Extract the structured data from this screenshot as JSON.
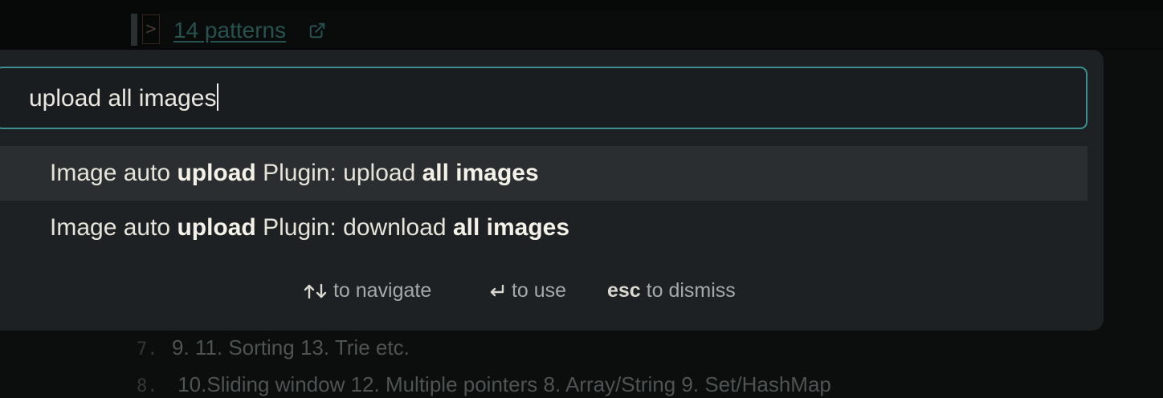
{
  "editor": {
    "link_text": "14 patterns",
    "caret_marker": ">",
    "lines": [
      {
        "number": "7.",
        "text": "9.  11. Sorting  13. Trie etc."
      },
      {
        "number": "8.",
        "text": " 10.Sliding window 12. Multiple pointers 8. Array/String 9. Set/HashMap"
      }
    ]
  },
  "palette": {
    "query": "upload all images",
    "suggestions": [
      {
        "parts": [
          "Image auto ",
          "upload",
          " Plugin: upload ",
          "all images"
        ],
        "selected": true
      },
      {
        "parts": [
          "Image auto ",
          "upload",
          " Plugin: download ",
          "all images"
        ],
        "selected": false
      }
    ],
    "hints": {
      "navigate": {
        "text": "to navigate"
      },
      "use": {
        "text": "to use"
      },
      "dismiss": {
        "key": "esc",
        "text": "to dismiss"
      }
    }
  },
  "colors": {
    "accent_border": "#3e8f8f",
    "palette_bg": "#1d2123",
    "selected_row_bg": "#2a2e30",
    "link": "#28524f"
  },
  "icons": [
    "external-link-icon",
    "arrow-up-icon",
    "arrow-down-icon",
    "enter-icon"
  ]
}
